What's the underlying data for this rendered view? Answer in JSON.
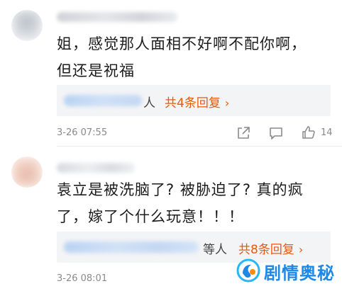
{
  "comments": [
    {
      "text_lines": [
        "姐，感觉那人面相不好啊不配你啊，",
        "但还是祝福"
      ],
      "reply_who": "人",
      "reply_link": "共4条回复",
      "time": "3-26 07:55",
      "like_count": "14"
    },
    {
      "text_lines": [
        "袁立是被洗脑了? 被胁迫了? 真的疯",
        "了，嫁了个什么玩意！！！"
      ],
      "reply_who": "等人",
      "reply_link": "共8条回复",
      "time": "3-26 08:01",
      "like_count": ""
    }
  ],
  "colors": {
    "accent": "#e8590c",
    "watermark": "#1e88e5",
    "meta": "#8a8a8a"
  },
  "icons": [
    "share-icon",
    "comment-icon",
    "like-icon",
    "chevron-right-icon"
  ],
  "watermark": {
    "text": "剧情奥秘"
  }
}
